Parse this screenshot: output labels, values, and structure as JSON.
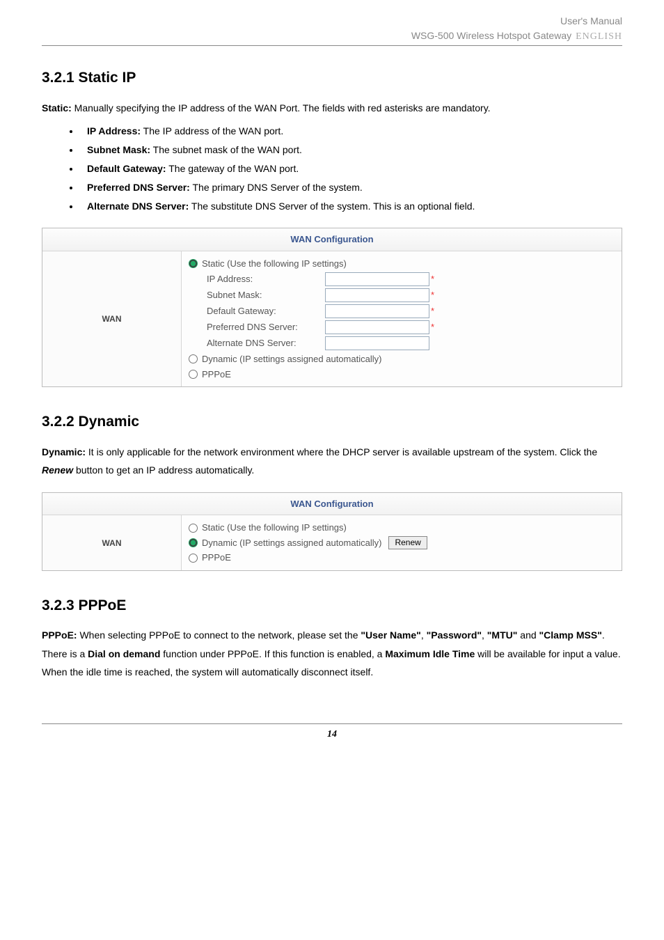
{
  "header": {
    "line1": "User's Manual",
    "line2a": "WSG-500 Wireless Hotspot Gateway",
    "line2b": "ENGLISH"
  },
  "sec321": {
    "heading": "3.2.1 Static IP",
    "intro_bold": "Static:",
    "intro_rest": " Manually specifying the IP address of the WAN Port. The fields with red asterisks are mandatory.",
    "bullets": [
      {
        "term": "IP Address:",
        "desc": " The IP address of the WAN port."
      },
      {
        "term": "Subnet Mask:",
        "desc": " The subnet mask of the WAN port."
      },
      {
        "term": "Default Gateway:",
        "desc": " The gateway of the WAN port."
      },
      {
        "term": "Preferred DNS Server:",
        "desc": " The primary DNS Server of the system."
      },
      {
        "term": "Alternate DNS Server:",
        "desc": " The substitute DNS Server of the system. This is an optional field."
      }
    ]
  },
  "wan1": {
    "title": "WAN Configuration",
    "left": "WAN",
    "opt_static": "Static (Use the following IP settings)",
    "opt_dynamic": "Dynamic (IP settings assigned automatically)",
    "opt_pppoe": "PPPoE",
    "fields": {
      "ip": "IP Address:",
      "mask": "Subnet Mask:",
      "gw": "Default Gateway:",
      "dns1": "Preferred DNS Server:",
      "dns2": "Alternate DNS Server:"
    }
  },
  "sec322": {
    "heading": "3.2.2 Dynamic",
    "p_bold": "Dynamic:",
    "p_rest1": " It is only applicable for the network environment where the DHCP server is available upstream of the system. Click the ",
    "p_renew": "Renew",
    "p_rest2": " button to get an IP address automatically."
  },
  "wan2": {
    "title": "WAN Configuration",
    "left": "WAN",
    "opt_static": "Static (Use the following IP settings)",
    "opt_dynamic": "Dynamic (IP settings assigned automatically)",
    "opt_pppoe": "PPPoE",
    "renew_btn": "Renew"
  },
  "sec323": {
    "heading": "3.2.3 PPPoE",
    "p": {
      "a": "PPPoE:",
      "b": " When selecting PPPoE to connect to the network, please set the ",
      "c": "\"User Name\"",
      "d": ", ",
      "e": "\"Password\"",
      "f": ", ",
      "g": "\"MTU\"",
      "h": " and ",
      "i": "\"Clamp MSS\"",
      "j": ". There is a ",
      "k": "Dial on demand",
      "l": " function under PPPoE. If this function is enabled, a ",
      "m": "Maximum Idle Time",
      "n": " will be available for input a value. When the idle time is reached, the system will automatically disconnect itself."
    }
  },
  "page_number": "14"
}
